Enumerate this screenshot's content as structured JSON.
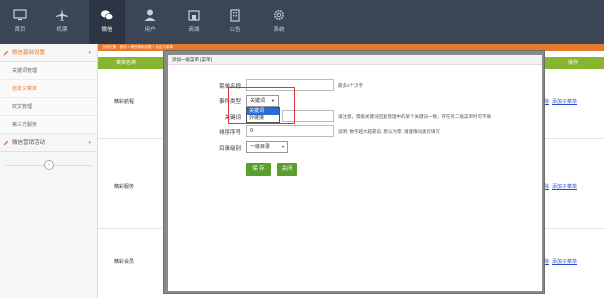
{
  "nav": {
    "items": [
      {
        "label": "首页",
        "icon": "monitor-icon"
      },
      {
        "label": "机票",
        "icon": "airplane-icon"
      },
      {
        "label": "微信",
        "icon": "wechat-icon"
      },
      {
        "label": "用户",
        "icon": "user-icon"
      },
      {
        "label": "商城",
        "icon": "store-icon"
      },
      {
        "label": "公告",
        "icon": "building-icon"
      },
      {
        "label": "系统",
        "icon": "gear-icon"
      }
    ],
    "active_index": 2
  },
  "sidebar": {
    "sections": [
      {
        "label": "微信基础设置",
        "items": [
          "关键词管理",
          "自定义菜单",
          "欢文管理",
          "第三方服务"
        ],
        "active_item": 1
      },
      {
        "label": "微信营销活动",
        "items": []
      }
    ]
  },
  "main": {
    "breadcrumb": "当前位置：微信 > 微信基础设置 > 自定义菜单",
    "columns": {
      "name": "菜单名称",
      "ops": "操作"
    },
    "rows": [
      {
        "name": "精彩航程",
        "ops": [
          "删除",
          "添加子菜单"
        ]
      },
      {
        "name": "精彩服务",
        "ops": [
          "删除",
          "添加子菜单"
        ]
      },
      {
        "name": "精彩会员",
        "ops": [
          "删除",
          "添加子菜单"
        ]
      }
    ]
  },
  "modal": {
    "title": "添加一级菜单 [菜单]",
    "fields": {
      "menu_name": {
        "label": "菜单名称",
        "value": "",
        "hint": "最多4个汉字"
      },
      "event_type": {
        "label": "事件类型",
        "value": "关键词",
        "options": [
          "关键词",
          "外链接"
        ]
      },
      "keyword": {
        "label": "关键词",
        "value": "",
        "hint": "请注意，需跟关键词回复管理中的某个关键词一致，存在有二级菜单时可不填"
      },
      "sort": {
        "label": "排序序号",
        "value": "0",
        "hint": "说明: 数字越大越靠前, 默认为零, 请谨慎同类仅填写"
      },
      "parent": {
        "label": "目录级别",
        "value": "一级目录"
      }
    },
    "save_label": "保 存",
    "close_label": "关闭"
  }
}
